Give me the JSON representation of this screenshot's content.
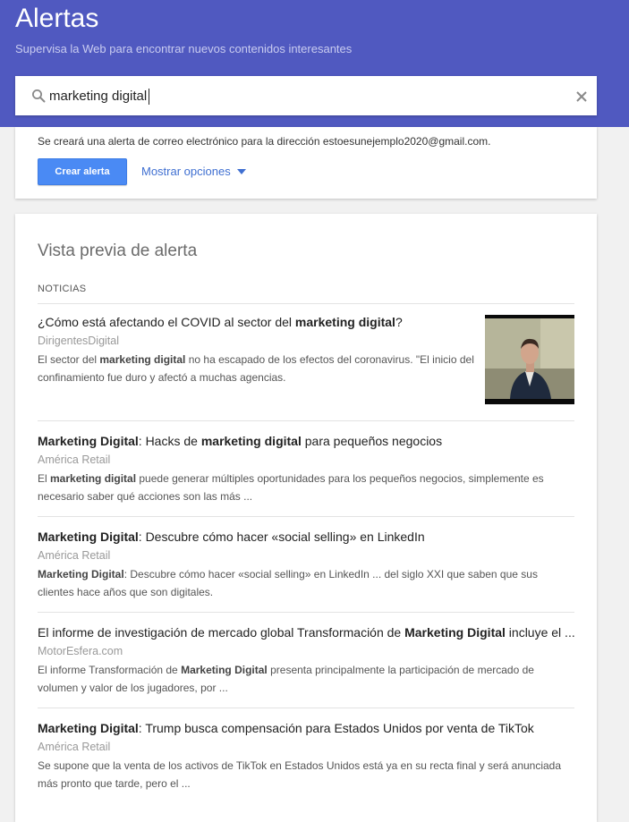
{
  "header": {
    "title": "Alertas",
    "subtitle": "Supervisa la Web para encontrar nuevos contenidos interesantes",
    "bg_color": "#5059c0"
  },
  "search": {
    "value": "marketing digital",
    "icon": "search-icon",
    "clear_icon": "close-icon"
  },
  "create": {
    "email_note": "Se creará una alerta de correo electrónico para la dirección estoesunejemplo2020@gmail.com.",
    "button_label": "Crear alerta",
    "options_label": "Mostrar opciones",
    "accent_color": "#4a8af4"
  },
  "preview": {
    "title": "Vista previa de alerta",
    "section_label": "NOTICIAS",
    "items": [
      {
        "title": [
          {
            "t": "¿Cómo está afectando el COVID al sector del "
          },
          {
            "t": "marketing digital",
            "b": true
          },
          {
            "t": "?"
          }
        ],
        "source": "DirigentesDigital",
        "snippet": [
          {
            "t": "El sector del "
          },
          {
            "t": "marketing digital",
            "b": true
          },
          {
            "t": " no ha escapado de los efectos del coronavirus. \"El inicio del confinamiento fue duro y afectó a muchas agencias."
          }
        ],
        "has_thumbnail": true
      },
      {
        "title": [
          {
            "t": "Marketing Digital",
            "b": true
          },
          {
            "t": ": Hacks de "
          },
          {
            "t": "marketing digital",
            "b": true
          },
          {
            "t": " para pequeños negocios"
          }
        ],
        "source": "América Retail",
        "snippet": [
          {
            "t": "El "
          },
          {
            "t": "marketing digital",
            "b": true
          },
          {
            "t": " puede generar múltiples oportunidades para los pequeños negocios, simplemente es necesario saber qué acciones son las más ..."
          }
        ]
      },
      {
        "title": [
          {
            "t": "Marketing Digital",
            "b": true
          },
          {
            "t": ": Descubre cómo hacer «social selling» en LinkedIn"
          }
        ],
        "source": "América Retail",
        "snippet": [
          {
            "t": "Marketing Digital",
            "b": true
          },
          {
            "t": ": Descubre cómo hacer «social selling» en LinkedIn ... del siglo XXI que saben que sus clientes hace años que son digitales."
          }
        ]
      },
      {
        "title": [
          {
            "t": "El informe de investigación de mercado global Transformación de "
          },
          {
            "t": "Marketing Digital",
            "b": true
          },
          {
            "t": " incluye el ..."
          }
        ],
        "source": "MotorEsfera.com",
        "snippet": [
          {
            "t": "El informe Transformación de "
          },
          {
            "t": "Marketing Digital",
            "b": true
          },
          {
            "t": " presenta principalmente la participación de mercado de volumen y valor de los jugadores, por ..."
          }
        ]
      },
      {
        "title": [
          {
            "t": "Marketing Digital",
            "b": true
          },
          {
            "t": ": Trump busca compensación para Estados Unidos por venta de TikTok"
          }
        ],
        "source": "América Retail",
        "snippet": [
          {
            "t": "Se supone que la venta de los activos de TikTok en Estados Unidos está ya en su recta final y será anunciada más pronto que tarde, pero el ..."
          }
        ]
      }
    ]
  }
}
